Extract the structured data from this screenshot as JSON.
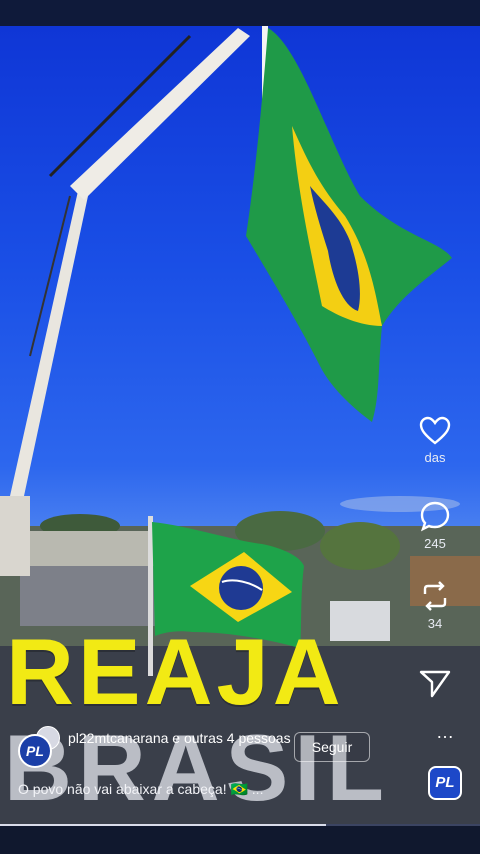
{
  "video": {
    "headline_line1": "REAJA",
    "headline_line2": "BRASIL",
    "progress_fraction": 0.68
  },
  "actions": {
    "like": {
      "icon": "heart-icon",
      "count": "das"
    },
    "comment": {
      "icon": "comment-icon",
      "count": "245"
    },
    "repost": {
      "icon": "repost-icon",
      "count": "34"
    },
    "share": {
      "icon": "share-icon"
    },
    "more": {
      "icon": "more-icon",
      "label": "…"
    }
  },
  "author": {
    "avatar_text": "PL",
    "username": "pl22mtcanarana e outras 4 pessoas",
    "follow_label": "Seguir"
  },
  "caption": "O povo não vai abaixar a cabeça! 🇧🇷 ...",
  "badge": {
    "text": "PL"
  },
  "colors": {
    "sky": "#1a4fe6",
    "flag_green": "#1e9b45",
    "flag_yellow": "#f5d40f",
    "flag_blue": "#1f3a93",
    "headline_yellow": "#f2ea14"
  }
}
